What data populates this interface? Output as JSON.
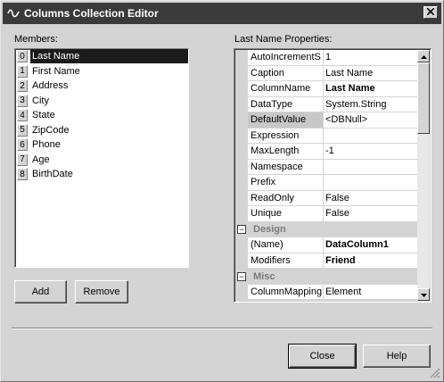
{
  "window": {
    "title": "Columns Collection Editor"
  },
  "members": {
    "label": "Members:",
    "items": [
      {
        "index": "0",
        "name": "Last Name",
        "selected": true
      },
      {
        "index": "1",
        "name": "First Name"
      },
      {
        "index": "2",
        "name": "Address"
      },
      {
        "index": "3",
        "name": "City"
      },
      {
        "index": "4",
        "name": "State"
      },
      {
        "index": "5",
        "name": "ZipCode"
      },
      {
        "index": "6",
        "name": "Phone"
      },
      {
        "index": "7",
        "name": "Age"
      },
      {
        "index": "8",
        "name": "BirthDate"
      }
    ]
  },
  "properties": {
    "label": "Last Name Properties:",
    "rows": [
      {
        "name": "AutoIncrementS",
        "value": "1"
      },
      {
        "name": "Caption",
        "value": "Last Name"
      },
      {
        "name": "ColumnName",
        "value": "Last Name",
        "bold": true
      },
      {
        "name": "DataType",
        "value": "System.String"
      },
      {
        "name": "DefaultValue",
        "value": "<DBNull>",
        "selected": true
      },
      {
        "name": "Expression",
        "value": ""
      },
      {
        "name": "MaxLength",
        "value": "-1"
      },
      {
        "name": "Namespace",
        "value": ""
      },
      {
        "name": "Prefix",
        "value": ""
      },
      {
        "name": "ReadOnly",
        "value": "False"
      },
      {
        "name": "Unique",
        "value": "False"
      }
    ],
    "design_category": "Design",
    "design_rows": [
      {
        "name": "(Name)",
        "value": "DataColumn1",
        "bold": true
      },
      {
        "name": "Modifiers",
        "value": "Friend",
        "bold": true
      }
    ],
    "misc_category": "Misc",
    "misc_rows": [
      {
        "name": "ColumnMapping",
        "value": "Element"
      }
    ]
  },
  "buttons": {
    "add": "Add",
    "remove": "Remove",
    "close": "Close",
    "help": "Help"
  },
  "icons": {
    "app": "vs-editor-icon",
    "close": "close-icon",
    "collapse": "minus-box-icon",
    "scroll_up": "scroll-up-arrow-icon",
    "scroll_down": "scroll-down-arrow-icon"
  },
  "colors": {
    "titlebar": "#3a3a3a",
    "selection": "#1a1a1a",
    "face": "#d4d4d4"
  }
}
